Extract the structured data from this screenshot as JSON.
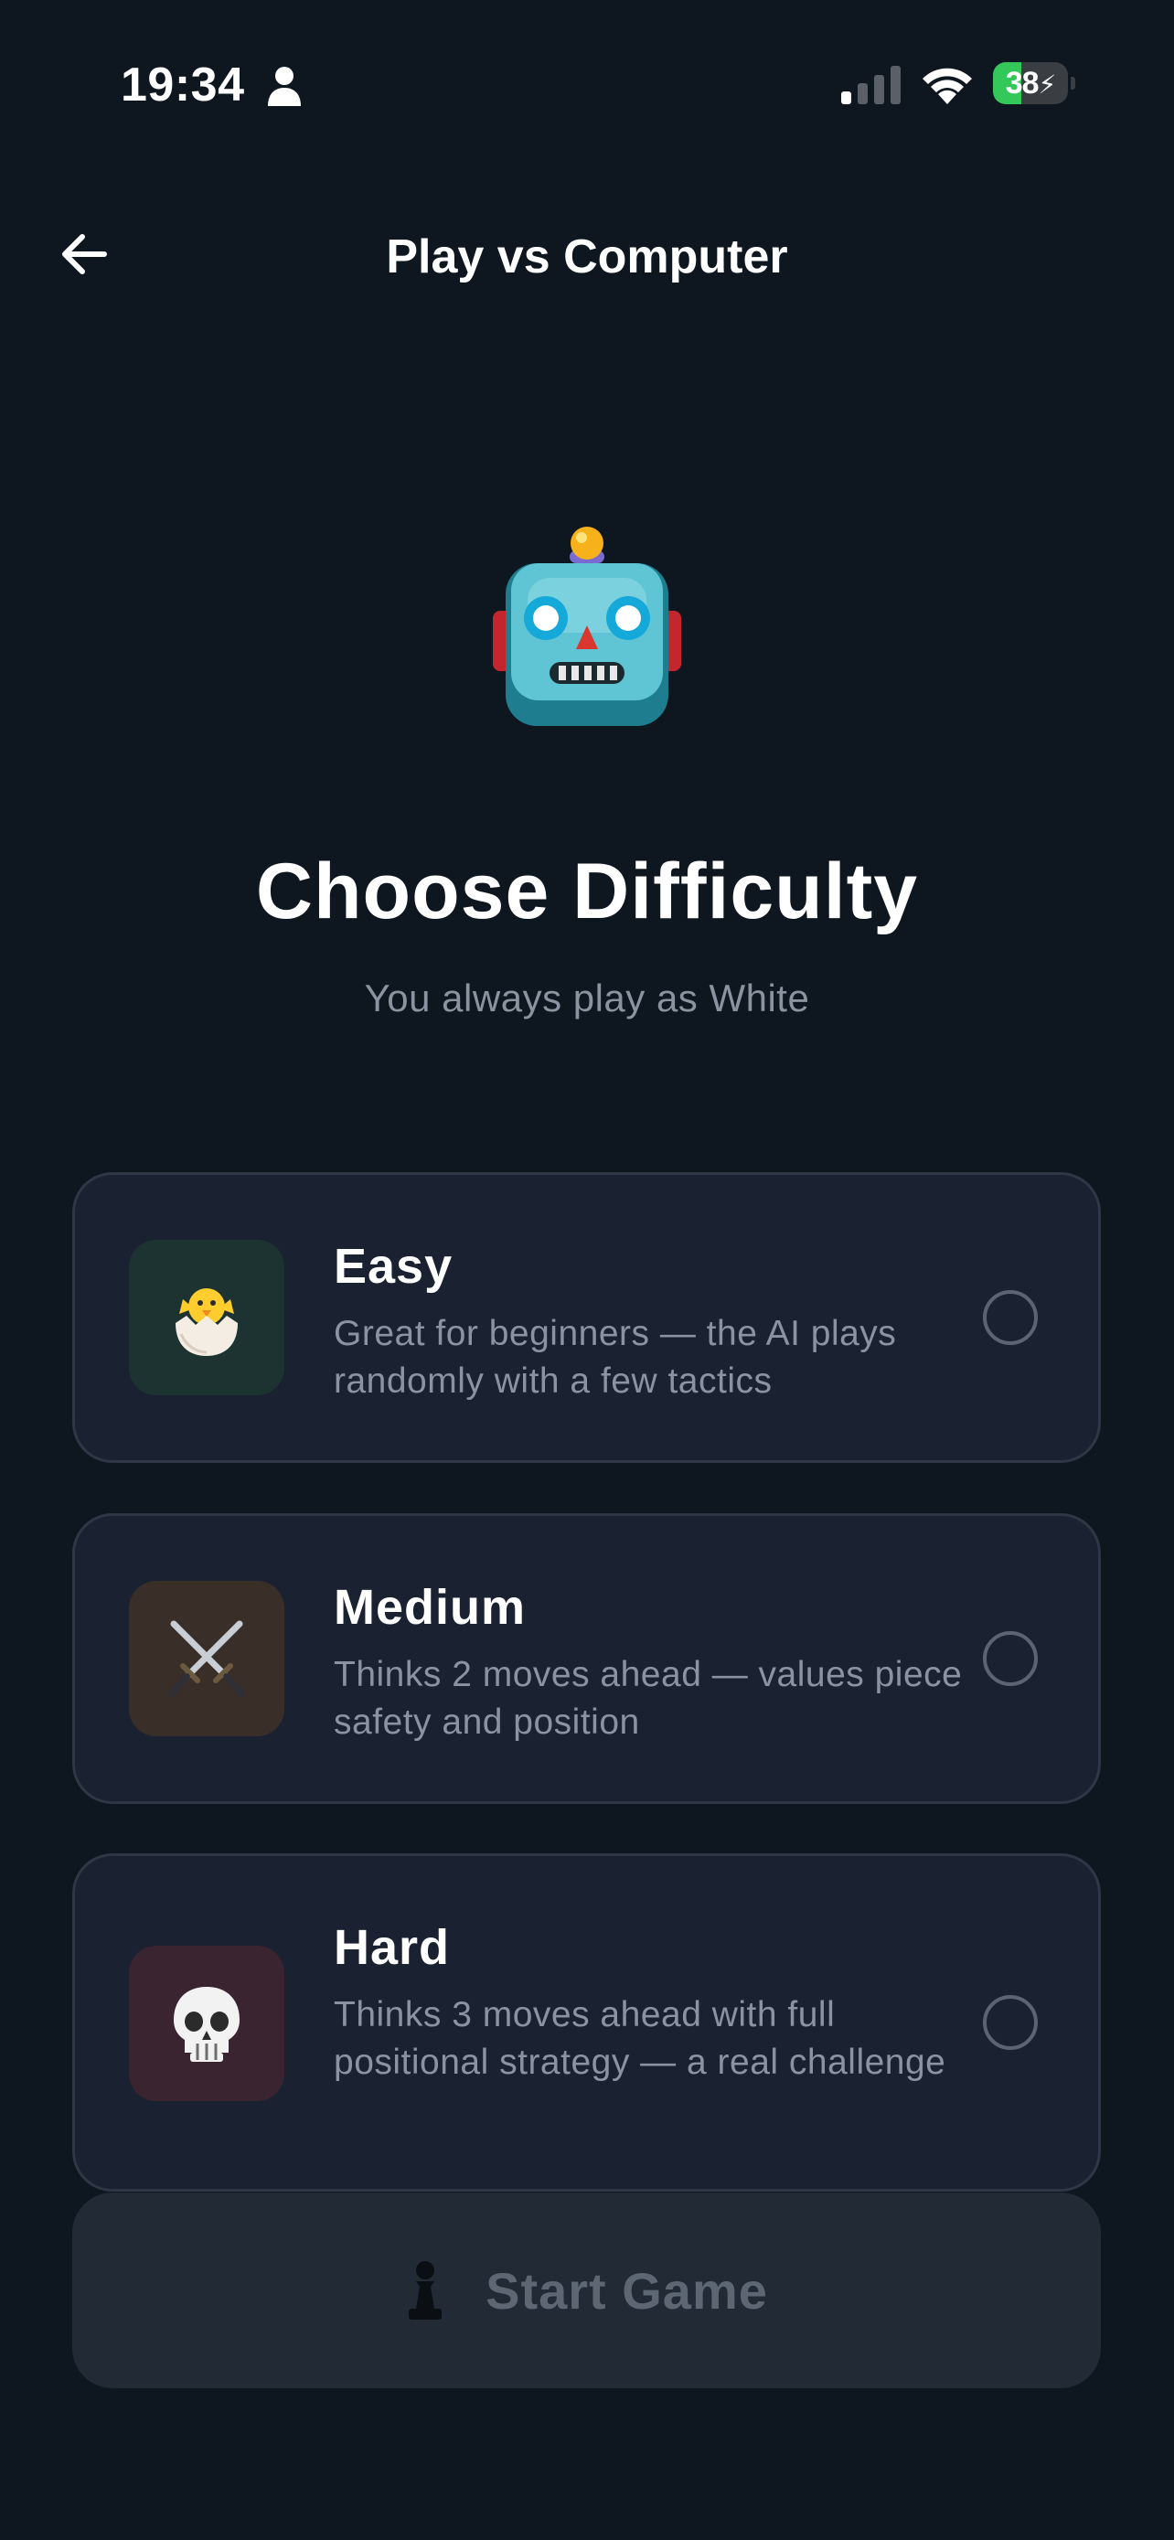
{
  "status_bar": {
    "time": "19:34",
    "battery": "38",
    "battery_level": 0.38,
    "icons": [
      "person-icon",
      "cellular-signal-icon",
      "wifi-icon",
      "battery-charging-icon"
    ]
  },
  "header": {
    "back_icon": "arrow-left-icon",
    "title": "Play vs Computer"
  },
  "hero": {
    "icon": "robot-icon",
    "title": "Choose Difficulty",
    "subtitle": "You always play as White"
  },
  "difficulties": [
    {
      "title": "Easy",
      "description": "Great for beginners — the AI plays randomly with a few tactics",
      "icon": "hatching-chick-icon",
      "icon_bg": "#1d3331",
      "selected": false
    },
    {
      "title": "Medium",
      "description": "Thinks 2 moves ahead — values piece safety and position",
      "icon": "crossed-swords-icon",
      "icon_bg": "#3a2f28",
      "selected": false
    },
    {
      "title": "Hard",
      "description": "Thinks 3 moves ahead with full positional strategy — a real challenge",
      "icon": "skull-icon",
      "icon_bg": "#3a2430",
      "selected": false
    }
  ],
  "start_button": {
    "icon": "chess-pawn-icon",
    "label": "Start Game",
    "enabled": false
  },
  "colors": {
    "background": "#0e161f",
    "card_background": "#1a2231",
    "card_border": "#2d3745",
    "muted_text": "#8a939f",
    "disabled_button": "#222a36",
    "disabled_text": "#5d6673",
    "battery_green": "#34c759"
  }
}
